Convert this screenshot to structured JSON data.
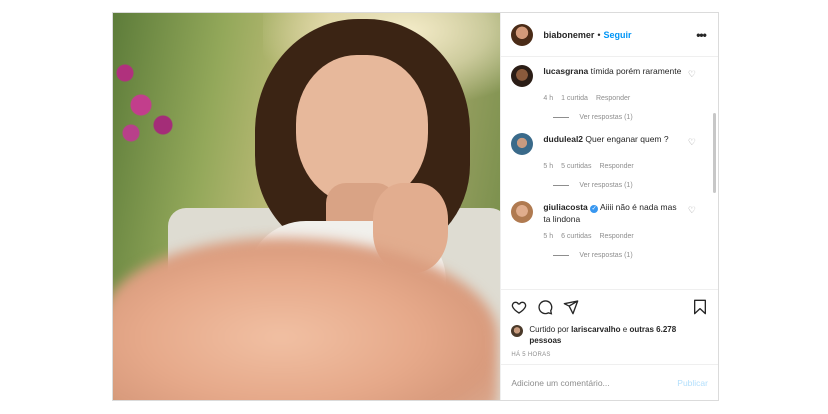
{
  "post": {
    "author": "biabonemer",
    "separator": "•",
    "follow_label": "Seguir",
    "more_label": "•••"
  },
  "comments": [
    {
      "username": "lucasgrana",
      "text": "tímida porém raramente",
      "time": "4 h",
      "likes": "1 curtida",
      "reply_label": "Responder",
      "view_replies": "Ver respostas (1)",
      "verified": false
    },
    {
      "username": "duduleal2",
      "text": "Quer enganar quem ?",
      "time": "5 h",
      "likes": "5 curtidas",
      "reply_label": "Responder",
      "view_replies": "Ver respostas (1)",
      "verified": false
    },
    {
      "username": "giuliacosta",
      "text": "Aiiii não é nada mas ta lindona",
      "time": "5 h",
      "likes": "6 curtidas",
      "reply_label": "Responder",
      "view_replies": "Ver respostas (1)",
      "verified": true
    }
  ],
  "likes_summary": {
    "prefix": "Curtido por",
    "user": "lariscarvalho",
    "connector": "e",
    "others": "outras 6.278 pessoas"
  },
  "timestamp": "HÁ 5 HORAS",
  "add_comment": {
    "placeholder": "Adicione um comentário...",
    "publish_label": "Publicar"
  },
  "colors": {
    "accent": "#0095f6",
    "publish_disabled": "#b2dffc",
    "muted": "#8e8e8e",
    "verified": "#3897f0"
  }
}
